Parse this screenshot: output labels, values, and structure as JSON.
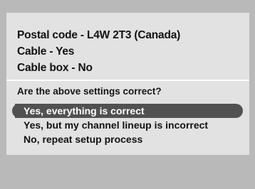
{
  "settings": {
    "postal_code": "Postal code  - L4W 2T3 (Canada)",
    "cable": "Cable - Yes",
    "cable_box": "Cable box - No"
  },
  "question": "Are the above settings correct?",
  "options": [
    {
      "label": "Yes, everything is correct",
      "selected": true
    },
    {
      "label": "Yes, but my channel lineup is incorrect",
      "selected": false
    },
    {
      "label": "No, repeat setup process",
      "selected": false
    }
  ],
  "colors": {
    "background": "#b9b9b9",
    "panel": "#e2e2e2",
    "highlight": "#515151",
    "text": "#111111"
  }
}
